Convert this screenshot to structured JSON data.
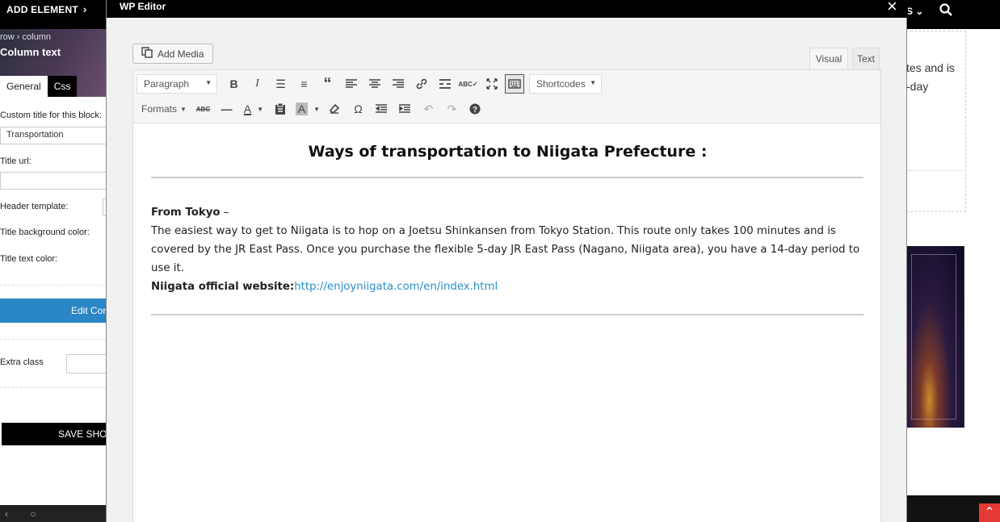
{
  "topbar": {
    "add_element_label": "ADD ELEMENT",
    "right_text": "S",
    "icons": [
      "chevron-right-icon",
      "chevron-down-icon",
      "search-icon"
    ]
  },
  "left_panel": {
    "breadcrumb_row": "row",
    "breadcrumb_column": "column",
    "title": "Column text",
    "tabs": [
      {
        "label": "General",
        "active": true
      },
      {
        "label": "Css",
        "active": false
      }
    ],
    "custom_title_label": "Custom title for this block:",
    "custom_title_value": "Transportation",
    "title_url_label": "Title url:",
    "header_template_label": "Header template:",
    "title_bg_label": "Title background color:",
    "title_text_color_label": "Title text color:",
    "edit_button": "Edit Con",
    "extra_class_label": "Extra class",
    "save_button": "SAVE SHOR"
  },
  "right_bg": {
    "text_line1": "tes and is",
    "text_line2": "-day"
  },
  "modal": {
    "title": "WP Editor",
    "add_media_label": "Add Media",
    "tab_visual": "Visual",
    "tab_text": "Text",
    "paragraph_select": "Paragraph",
    "shortcodes_select": "Shortcodes",
    "formats_label": "Formats",
    "accent_color": "#2b86c5",
    "link_color": "#2a8fc9"
  },
  "content": {
    "heading": "Ways of transportation to Niigata Prefecture :",
    "from_label": "From Tokyo",
    "from_dash": " –",
    "paragraph": "The easiest way to get to Niigata is to hop on a Joetsu Shinkansen from Tokyo Station. This route only takes 100 minutes and is covered by the JR East Pass. Once you purchase the flexible 5-day JR East Pass (Nagano, Niigata area), you have a 14-day period to use it.",
    "website_label": "Niigata official website:",
    "website_url": "http://enjoyniigata.com/en/index.html"
  }
}
